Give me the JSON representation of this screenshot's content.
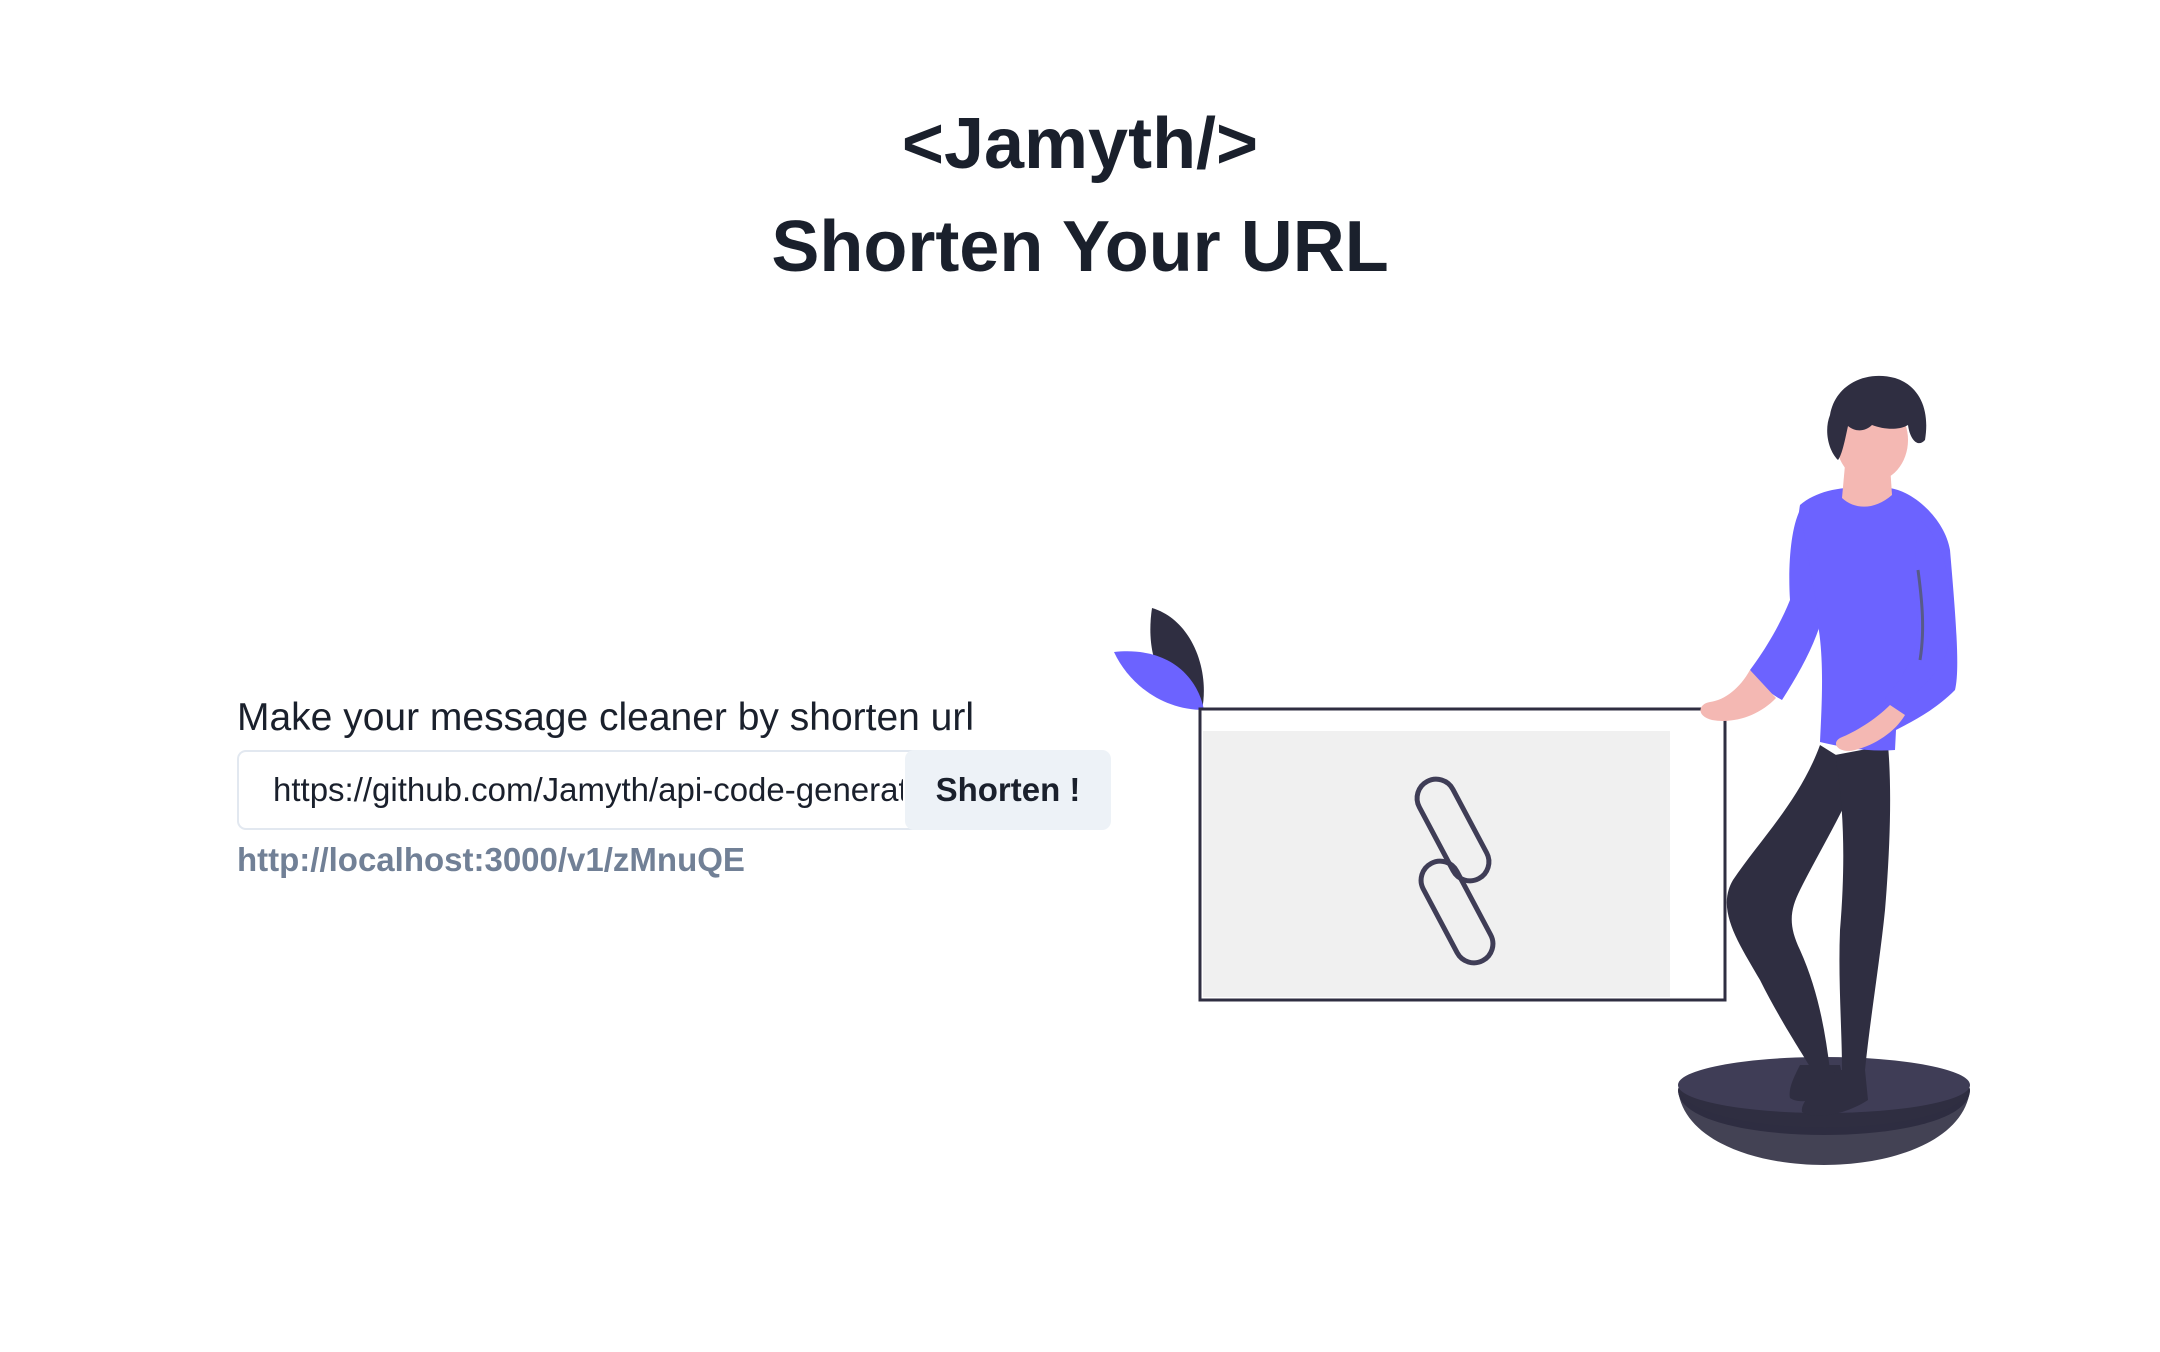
{
  "header": {
    "brand": "<Jamyth/>",
    "title": "Shorten Your URL"
  },
  "form": {
    "lead": "Make your message cleaner by shorten url",
    "input_value": "https://github.com/Jamyth/api-code-generator",
    "button_label": "Shorten !",
    "result_url": "http://localhost:3000/v1/zMnuQE"
  },
  "illustration": {
    "icon": "link-chain-icon",
    "accent_color": "#6c63ff",
    "dark_color": "#2f2e41"
  }
}
